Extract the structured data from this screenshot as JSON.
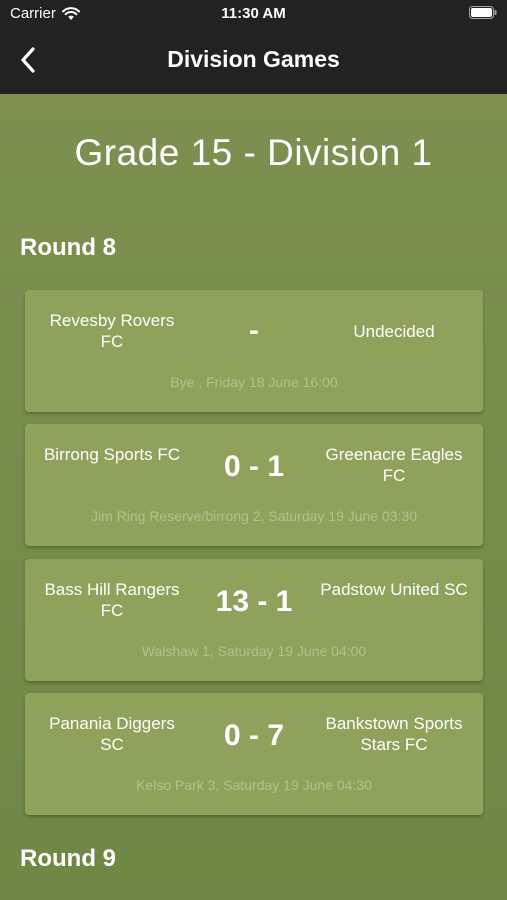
{
  "status_bar": {
    "carrier": "Carrier",
    "time": "11:30 AM"
  },
  "nav": {
    "title": "Division Games"
  },
  "page": {
    "title": "Grade 15 - Division 1"
  },
  "rounds": [
    {
      "label": "Round 8",
      "matches": [
        {
          "home": "Revesby Rovers FC",
          "score": "-",
          "away": "Undecided",
          "venue": "Bye , Friday 18 June 16:00"
        },
        {
          "home": "Birrong Sports FC",
          "score": "0 - 1",
          "away": "Greenacre Eagles FC",
          "venue": "Jim Ring Reserve/birrong 2, Saturday 19 June 03:30"
        },
        {
          "home": "Bass Hill Rangers FC",
          "score": "13 - 1",
          "away": "Padstow United SC",
          "venue": "Walshaw 1, Saturday 19 June 04:00"
        },
        {
          "home": "Panania Diggers SC",
          "score": "0 - 7",
          "away": "Bankstown Sports Stars FC",
          "venue": "Kelso Park 3, Saturday 19 June 04:30"
        }
      ]
    },
    {
      "label": "Round 9",
      "matches": []
    }
  ],
  "icons": {
    "back": "chevron-left-icon",
    "wifi": "wifi-icon",
    "battery": "battery-icon"
  },
  "colors": {
    "background": "#7d9150",
    "card": "#8ea25c",
    "nav_bar": "#222222",
    "venue_text": "#b3c28c",
    "text": "#ffffff"
  }
}
